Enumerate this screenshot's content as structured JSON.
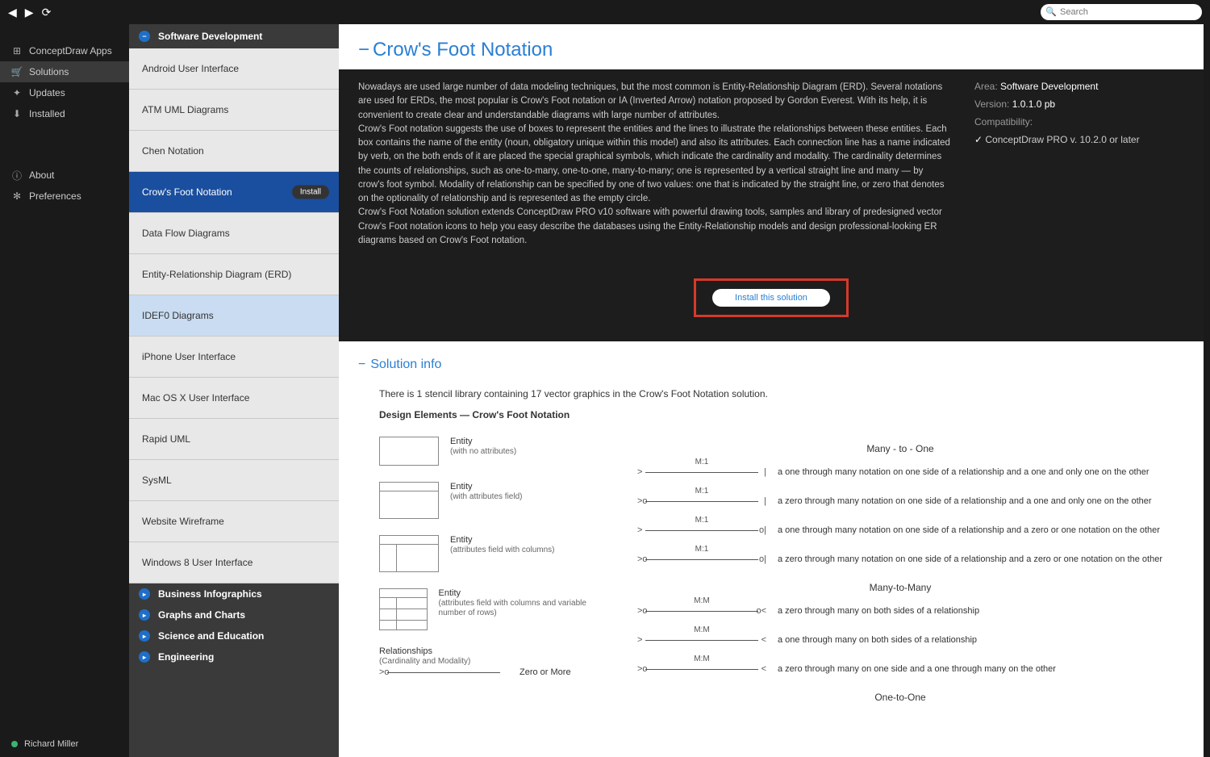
{
  "topbar": {
    "search_placeholder": "Search"
  },
  "leftbar": {
    "items": [
      {
        "icon": "apps",
        "label": "ConceptDraw Apps"
      },
      {
        "icon": "cart",
        "label": "Solutions",
        "active": true
      },
      {
        "icon": "updates",
        "label": "Updates"
      },
      {
        "icon": "installed",
        "label": "Installed"
      }
    ],
    "items2": [
      {
        "icon": "about",
        "label": "About"
      },
      {
        "icon": "prefs",
        "label": "Preferences"
      }
    ],
    "user": "Richard Miller"
  },
  "catcol": {
    "header": "Software Development",
    "items": [
      {
        "label": "Android User Interface"
      },
      {
        "label": "ATM UML Diagrams"
      },
      {
        "label": "Chen Notation"
      },
      {
        "label": "Crow's Foot Notation",
        "selected": true,
        "pill": "Install"
      },
      {
        "label": "Data Flow Diagrams"
      },
      {
        "label": "Entity-Relationship Diagram (ERD)"
      },
      {
        "label": "IDEF0 Diagrams",
        "hover": true
      },
      {
        "label": "iPhone User Interface"
      },
      {
        "label": "Mac OS X User Interface"
      },
      {
        "label": "Rapid UML"
      },
      {
        "label": "SysML"
      },
      {
        "label": "Website Wireframe"
      },
      {
        "label": "Windows 8 User Interface"
      }
    ],
    "footer": [
      "Business Infographics",
      "Graphs and Charts",
      "Science and Education",
      "Engineering"
    ]
  },
  "main": {
    "title": "Crow's Foot Notation",
    "description": "Nowadays are used large number of data modeling techniques, but the most common is Entity-Relationship Diagram (ERD). Several notations are used for ERDs, the most popular is Crow's Foot notation or IA (Inverted Arrow) notation proposed by Gordon Everest. With its help, it is convenient to create clear and understandable diagrams with large number of attributes.\nCrow's Foot notation suggests the use of boxes to represent the entities and the lines to illustrate the relationships between these entities. Each box contains the name of the entity (noun, obligatory unique within this model) and also its attributes. Each connection line has a name indicated by verb, on the both ends of it are placed the special graphical symbols, which indicate the cardinality and modality. The cardinality determines the counts of relationships, such as one-to-many, one-to-one, many-to-many; one is represented by a vertical straight line and many — by crow's foot symbol. Modality of relationship can be specified by one of two values: one that is indicated by the straight line, or zero that denotes on the optionality of relationship and is represented as the empty circle.\nCrow's Foot Notation solution extends ConceptDraw PRO v10 software with powerful drawing tools, samples and library of predesigned vector Crow's Foot notation icons to help you easy describe the databases using the Entity-Relationship models and design professional-looking ER diagrams based on Crow's Foot notation.",
    "meta": {
      "area": {
        "label": "Area:",
        "value": "Software Development"
      },
      "version": {
        "label": "Version:",
        "value": "1.0.1.0 pb"
      },
      "compat_label": "Compatibility:",
      "compat_value": "ConceptDraw PRO v. 10.2.0 or later"
    },
    "install_btn": "Install this solution",
    "section_title": "Solution info",
    "library_line": "There is 1 stencil library containing 17 vector graphics in the Crow's Foot Notation solution.",
    "design_elements": "Design Elements — Crow's Foot Notation",
    "entities": [
      {
        "title": "Entity",
        "sub": "(with no attributes)",
        "variant": "plain"
      },
      {
        "title": "Entity",
        "sub": "(with attributes field)",
        "variant": "tall"
      },
      {
        "title": "Entity",
        "sub": "(attributes field with columns)",
        "variant": "split"
      },
      {
        "title": "Entity",
        "sub": "(attributes field with columns and variable number of rows)",
        "variant": "rows"
      }
    ],
    "rel_heading": "Relationships",
    "rel_sub": "(Cardinality and Modality)",
    "zero_or_more": "Zero or More",
    "many_to_one_title": "Many - to - One",
    "many_to_one": [
      {
        "lbl": "M:1",
        "l": ">",
        "r": "|",
        "desc": "a one through many notation on one side of a relationship and a one and only one on the other"
      },
      {
        "lbl": "M:1",
        "l": ">o",
        "r": "|",
        "desc": "a zero through many notation on one side of a relationship and a one and only one on the other"
      },
      {
        "lbl": "M:1",
        "l": ">",
        "r": "o|",
        "desc": "a one through many notation on one side of a relationship and a zero or one notation on the other"
      },
      {
        "lbl": "M:1",
        "l": ">o",
        "r": "o|",
        "desc": "a zero through many notation on one side of a relationship and a zero or one notation on the other"
      }
    ],
    "many_to_many_title": "Many-to-Many",
    "many_to_many": [
      {
        "lbl": "M:M",
        "l": ">o",
        "r": "o<",
        "desc": "a zero through many on both sides of a relationship"
      },
      {
        "lbl": "M:M",
        "l": ">",
        "r": "<",
        "desc": "a one through many on both sides of a relationship"
      },
      {
        "lbl": "M:M",
        "l": ">o",
        "r": "<",
        "desc": "a zero through many on one side and a one through many on the other"
      }
    ],
    "one_to_one_title": "One-to-One"
  }
}
